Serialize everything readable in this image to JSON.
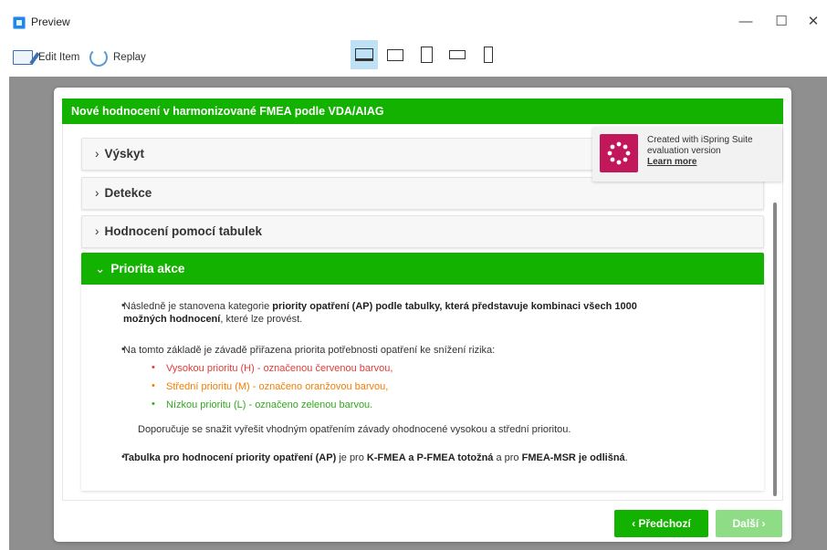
{
  "window": {
    "title": "Preview",
    "minimize": "—",
    "maximize": "☐",
    "close": "✕"
  },
  "toolbar": {
    "edit_label": "Edit Item",
    "replay_label": "Replay"
  },
  "card": {
    "header": "Nové hodnocení v harmonizované FMEA podle VDA/AIAG"
  },
  "accordion": [
    {
      "label": "Výskyt",
      "state": "collapsed"
    },
    {
      "label": "Detekce",
      "state": "collapsed"
    },
    {
      "label": "Hodnocení pomocí tabulek",
      "state": "collapsed"
    },
    {
      "label": "Priorita akce",
      "state": "expanded"
    }
  ],
  "content": {
    "p1_a": "Následně je stanovena kategorie ",
    "p1_b": "priority opatření (AP) podle tabulky, která představuje kombinaci všech 1000",
    "p1_c": "možných hodnocení",
    "p1_d": ", které lze provést.",
    "p2": "Na tomto základě je závadě přiřazena priorita potřebnosti opatření ke snížení rizika:",
    "sub_high": "Vysokou prioritu (H) - označenou červenou barvou,",
    "sub_med": "Střední prioritu (M) - označeno oranžovou barvou,",
    "sub_low": "Nízkou prioritu (L) - označeno zelenou barvou.",
    "p3": "Doporučuje se snažit vyřešit vhodným opatřením závady ohodnocené vysokou a střední prioritou.",
    "p4_a": "Tabulka pro hodnocení priority opatření (AP)",
    "p4_b": " je pro ",
    "p4_c": "K-FMEA a P-FMEA totožná",
    "p4_d": " a pro ",
    "p4_e": "FMEA-MSR je odlišná",
    "p4_f": "."
  },
  "watermark": {
    "line1": "Created with iSpring Suite",
    "line2": "evaluation version",
    "link": "Learn more"
  },
  "nav": {
    "prev": "‹ Předchozí",
    "next": "Další ›"
  },
  "colors": {
    "accent": "#13b200",
    "high": "#e53935",
    "medium": "#f57c00",
    "low": "#2eaa1a"
  }
}
